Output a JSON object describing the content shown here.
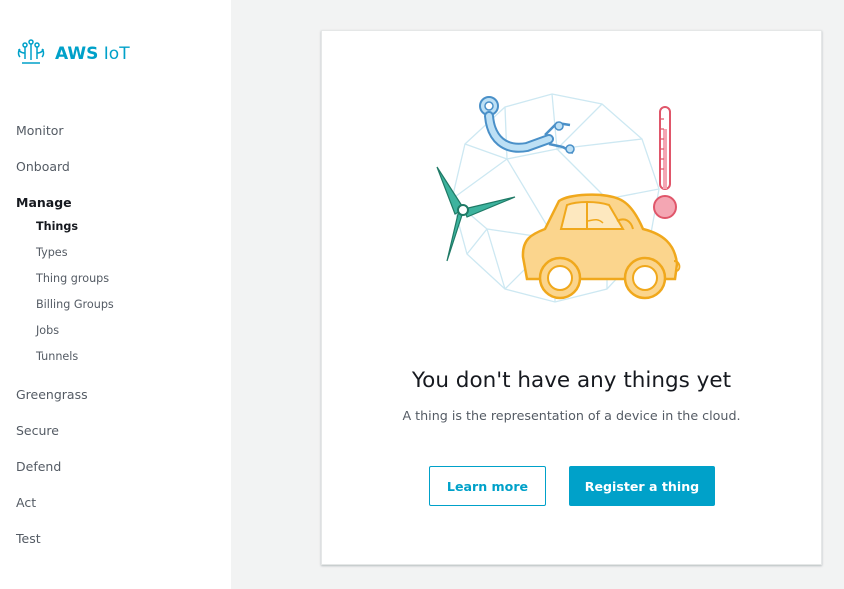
{
  "sidebar": {
    "brand": {
      "name_bold": "AWS",
      "name_rest": "IoT",
      "icon": "aws-iot-icon"
    },
    "sections": {
      "monitor": "Monitor",
      "onboard": "Onboard",
      "manage": "Manage",
      "greengrass": "Greengrass",
      "secure": "Secure",
      "defend": "Defend",
      "act": "Act",
      "test": "Test"
    },
    "manage_items": [
      "Things",
      "Types",
      "Thing groups",
      "Billing Groups",
      "Jobs",
      "Tunnels"
    ],
    "active_item": "Things"
  },
  "empty_state": {
    "illustration": "connected-car-illustration",
    "title": "You don't have any things yet",
    "description": "A thing is the representation of a device in the cloud.",
    "learn_more_label": "Learn more",
    "register_label": "Register a thing"
  },
  "colors": {
    "accent": "#00a1c9",
    "background": "#f2f3f3",
    "text_primary": "#16191f",
    "text_secondary": "#545b64"
  }
}
